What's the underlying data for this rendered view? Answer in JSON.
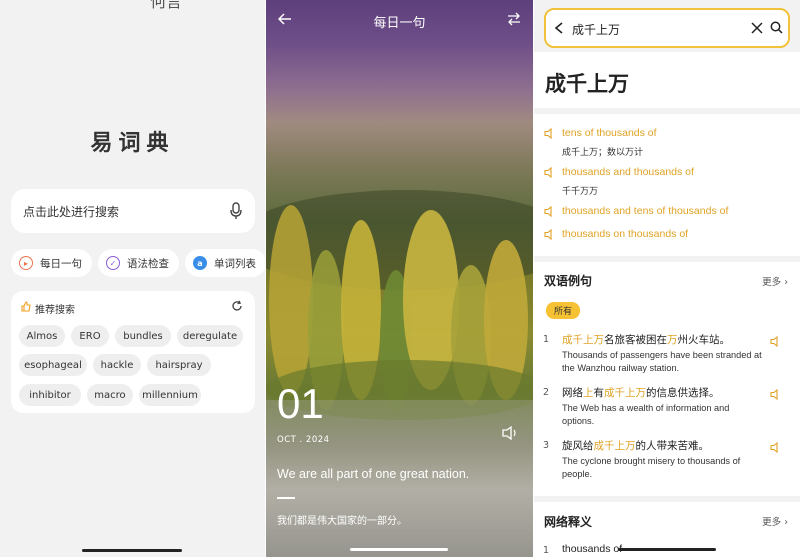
{
  "panel_home": {
    "top_fragment": "何言",
    "app_title": "易词典",
    "search_placeholder": "点击此处进行搜索",
    "shortcuts": [
      {
        "label": "每日一句",
        "icon": "daily-sentence-icon",
        "color": "#e8734f"
      },
      {
        "label": "语法检查",
        "icon": "grammar-check-icon",
        "color": "#8a5bd6"
      },
      {
        "label": "单词列表",
        "icon": "word-list-icon",
        "color": "#3a8ee8"
      }
    ],
    "recommend_title": "推荐搜索",
    "recommend_tags": [
      "Almos",
      "ERO",
      "bundles",
      "deregulate",
      "esophageal",
      "hackle",
      "hairspray",
      "inhibitor",
      "macro",
      "millennium"
    ]
  },
  "panel_daily": {
    "title": "每日一句",
    "day": "01",
    "month_year": "OCT . 2024",
    "quote_en": "We are all part of one great nation.",
    "quote_zh": "我们都是伟大国家的一部分。"
  },
  "panel_result": {
    "query": "成千上万",
    "headword": "成千上万",
    "accent_color": "#e0a224",
    "definitions": [
      {
        "en": "tens of thousands of",
        "zh": "成千上万；数以万计"
      },
      {
        "en": "thousands and thousands of",
        "zh": "千千万万"
      },
      {
        "en": "thousands and tens of thousands of",
        "zh": ""
      },
      {
        "en": "thousands on thousands of",
        "zh": ""
      }
    ],
    "examples_title": "双语例句",
    "more_label": "更多",
    "filter_badge": "所有",
    "examples": [
      {
        "num": "1",
        "zh_parts": [
          [
            "成千上万",
            true
          ],
          [
            "名旅客被困在",
            false
          ],
          [
            "万",
            true
          ],
          [
            "州火车站。",
            false
          ]
        ],
        "en": "Thousands of passengers have been stranded at the Wanzhou railway station."
      },
      {
        "num": "2",
        "zh_parts": [
          [
            "网络",
            false
          ],
          [
            "上",
            true
          ],
          [
            "有",
            false
          ],
          [
            "成千上万",
            true
          ],
          [
            "的信息供选择。",
            false
          ]
        ],
        "en": "The Web has a wealth of information and options."
      },
      {
        "num": "3",
        "zh_parts": [
          [
            "旋风给",
            false
          ],
          [
            "成千上万",
            true
          ],
          [
            "的人带来苦难。",
            false
          ]
        ],
        "en": "The cyclone brought misery to thousands of people."
      }
    ],
    "network_title": "网络释义",
    "network_more": "更多",
    "network_items": [
      {
        "num": "1",
        "text": "thousands of"
      }
    ]
  }
}
